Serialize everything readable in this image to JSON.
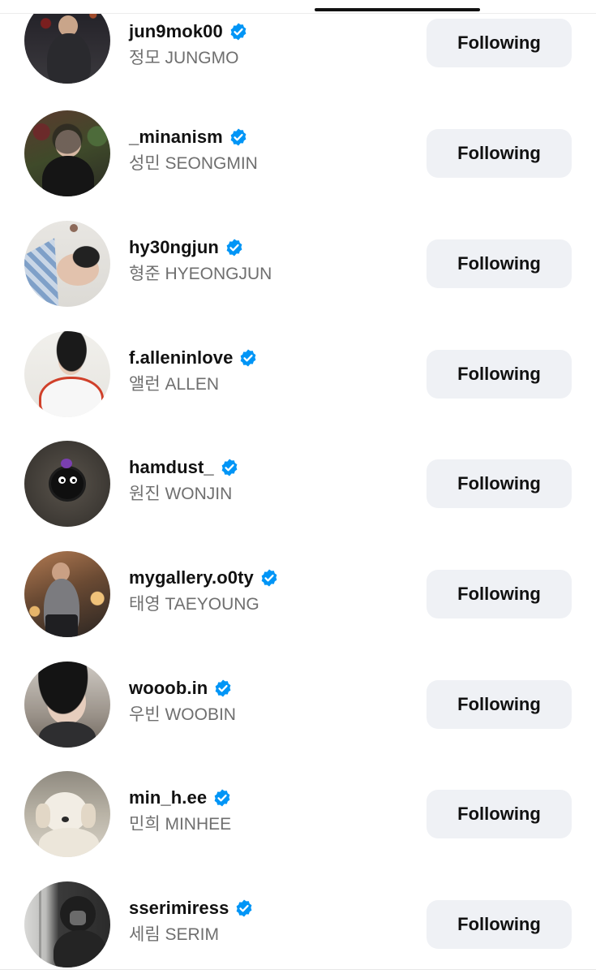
{
  "accounts": [
    {
      "username": "jun9mok00",
      "name": "정모 JUNGMO",
      "button": "Following",
      "verified": true
    },
    {
      "username": "_minanism",
      "name": "성민 SEONGMIN",
      "button": "Following",
      "verified": true
    },
    {
      "username": "hy30ngjun",
      "name": "형준 HYEONGJUN",
      "button": "Following",
      "verified": true
    },
    {
      "username": "f.alleninlove",
      "name": "앨런 ALLEN",
      "button": "Following",
      "verified": true
    },
    {
      "username": "hamdust_",
      "name": "원진 WONJIN",
      "button": "Following",
      "verified": true
    },
    {
      "username": "mygallery.o0ty",
      "name": "태영 TAEYOUNG",
      "button": "Following",
      "verified": true
    },
    {
      "username": "wooob.in",
      "name": "우빈 WOOBIN",
      "button": "Following",
      "verified": true
    },
    {
      "username": "min_h.ee",
      "name": "민희 MINHEE",
      "button": "Following",
      "verified": true
    },
    {
      "username": "sserimiress",
      "name": "세림 SERIM",
      "button": "Following",
      "verified": true
    }
  ],
  "colors": {
    "verified_badge": "#0095f6",
    "button_bg": "#eff1f5",
    "secondary_text": "#6f6f6f"
  },
  "icons": {
    "verified": "verified-badge-icon"
  }
}
